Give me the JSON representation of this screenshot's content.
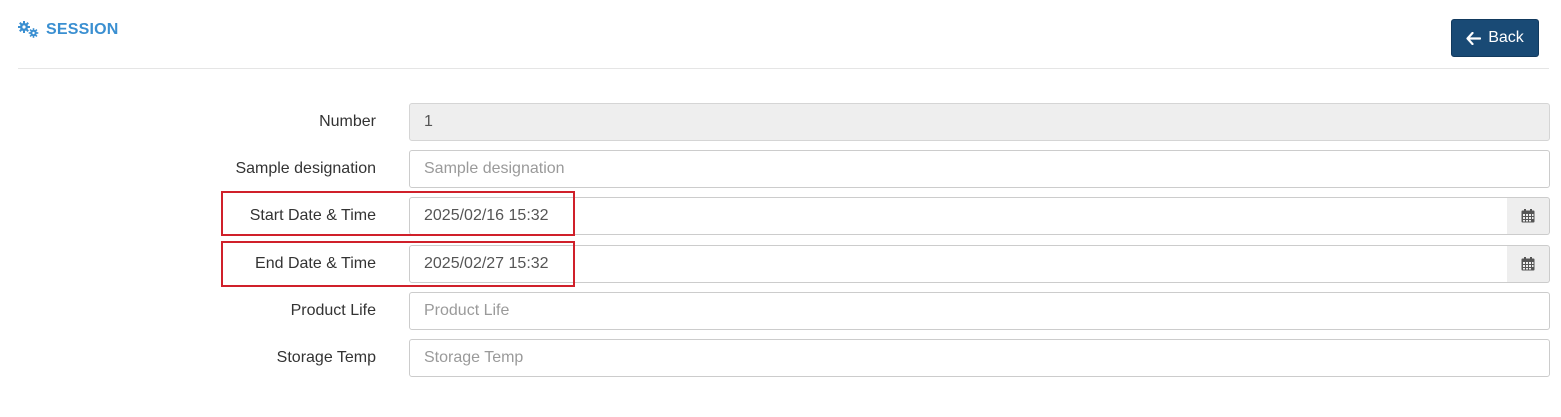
{
  "header": {
    "title": "SESSION",
    "title_icon": "gears-icon",
    "back_label": "Back",
    "back_icon": "arrow-left-icon"
  },
  "form": {
    "number": {
      "label": "Number",
      "value": "1"
    },
    "sample_designation": {
      "label": "Sample designation",
      "value": "",
      "placeholder": "Sample designation"
    },
    "start_datetime": {
      "label": "Start Date & Time",
      "value": "2025/02/16 15:32",
      "icon": "calendar-icon"
    },
    "end_datetime": {
      "label": "End Date & Time",
      "value": "2025/02/27 15:32",
      "icon": "calendar-icon"
    },
    "product_life": {
      "label": "Product Life",
      "value": "",
      "placeholder": "Product Life"
    },
    "storage_temp": {
      "label": "Storage Temp",
      "value": "",
      "placeholder": "Storage Temp"
    }
  },
  "colors": {
    "title": "#3a8fd1",
    "back_button": "#194a75",
    "highlight": "#d0202a",
    "readonly_bg": "#eeeeee"
  }
}
